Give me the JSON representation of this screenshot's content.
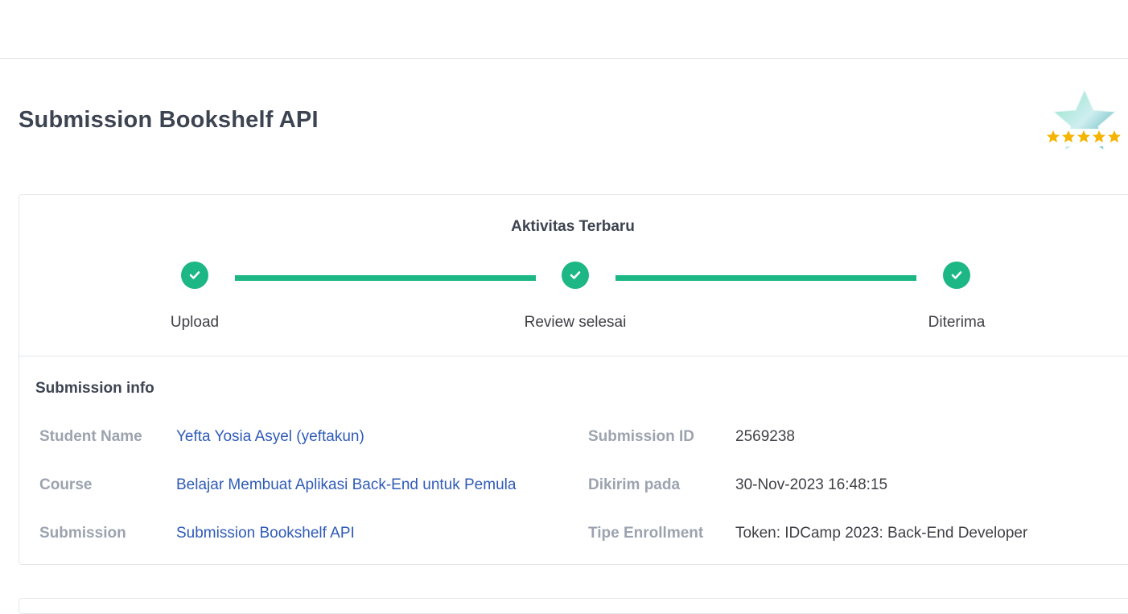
{
  "header": {
    "title": "Submission Bookshelf API"
  },
  "colors": {
    "accent_green": "#1cb784",
    "link_blue": "#2f5bb7",
    "label_gray": "#9ca3af",
    "star_yellow": "#f5b400"
  },
  "activity": {
    "title": "Aktivitas Terbaru",
    "steps": [
      {
        "label": "Upload",
        "status": "complete",
        "icon": "check-icon"
      },
      {
        "label": "Review selesai",
        "status": "complete",
        "icon": "check-icon"
      },
      {
        "label": "Diterima",
        "status": "complete",
        "icon": "check-icon"
      }
    ]
  },
  "rating": {
    "stars": 5,
    "max": 5,
    "icon": "star-badge-icon"
  },
  "info": {
    "title": "Submission info",
    "student_name_label": "Student Name",
    "student_name": "Yefta Yosia Asyel (yeftakun)",
    "course_label": "Course",
    "course": "Belajar Membuat Aplikasi Back-End untuk Pemula",
    "submission_label": "Submission",
    "submission": "Submission Bookshelf API",
    "submission_id_label": "Submission ID",
    "submission_id": "2569238",
    "sent_at_label": "Dikirim pada",
    "sent_at": "30-Nov-2023 16:48:15",
    "enrollment_label": "Tipe Enrollment",
    "enrollment": "Token: IDCamp 2023: Back-End Developer"
  }
}
